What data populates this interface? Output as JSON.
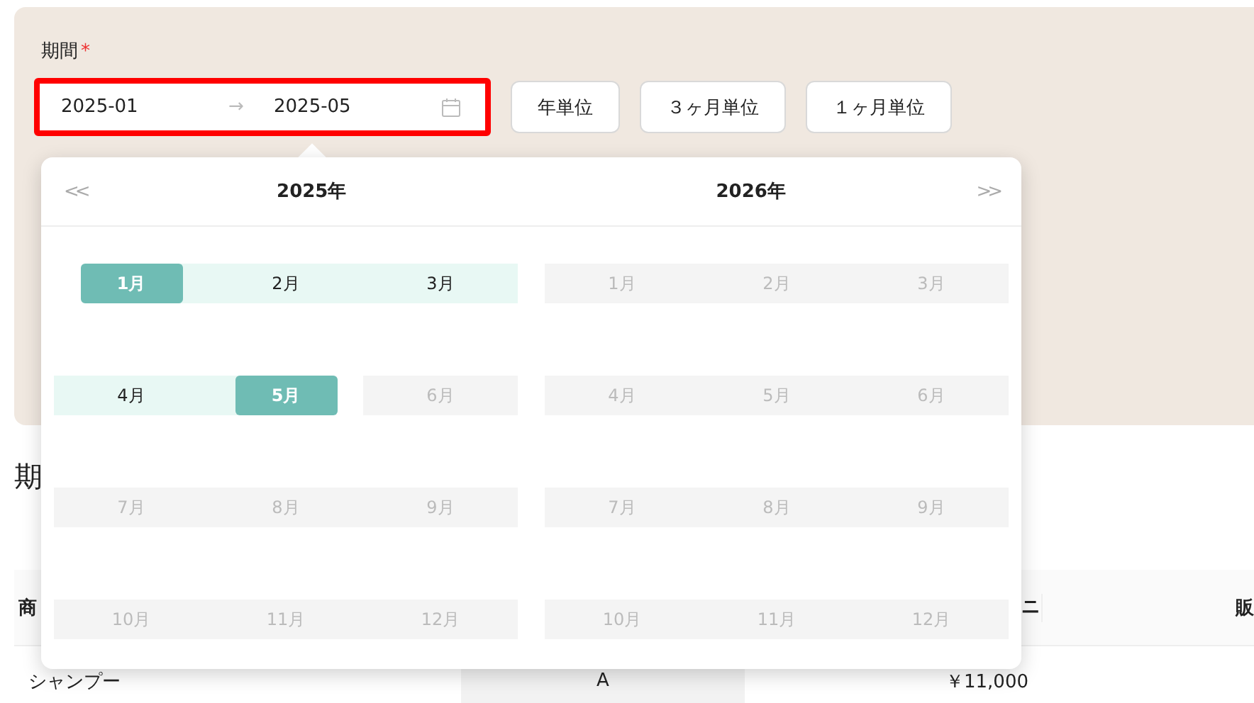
{
  "form": {
    "label": "期間",
    "required_mark": "*",
    "range": {
      "start": "2025-01",
      "separator": "→",
      "end": "2025-05",
      "highlighted": true
    },
    "buttons": [
      "年単位",
      "３ヶ月単位",
      "１ヶ月単位"
    ]
  },
  "section_heading": "期",
  "table": {
    "columns": [
      "商",
      "ニ",
      "販"
    ],
    "rows": [
      {
        "cells": [
          "シャンプー",
          "A",
          "￥11,000"
        ]
      }
    ]
  },
  "picker": {
    "prev_label": "<<",
    "next_label": ">>",
    "panels": [
      {
        "title": "2025年",
        "months": [
          {
            "label": "1月",
            "selected": true,
            "in_range": false,
            "disabled": false
          },
          {
            "label": "2月",
            "selected": false,
            "in_range": true,
            "disabled": false
          },
          {
            "label": "3月",
            "selected": false,
            "in_range": true,
            "disabled": false
          },
          {
            "label": "4月",
            "selected": false,
            "in_range": true,
            "disabled": false
          },
          {
            "label": "5月",
            "selected": true,
            "in_range": false,
            "disabled": false
          },
          {
            "label": "6月",
            "selected": false,
            "in_range": false,
            "disabled": true
          },
          {
            "label": "7月",
            "selected": false,
            "in_range": false,
            "disabled": true
          },
          {
            "label": "8月",
            "selected": false,
            "in_range": false,
            "disabled": true
          },
          {
            "label": "9月",
            "selected": false,
            "in_range": false,
            "disabled": true
          },
          {
            "label": "10月",
            "selected": false,
            "in_range": false,
            "disabled": true
          },
          {
            "label": "11月",
            "selected": false,
            "in_range": false,
            "disabled": true
          },
          {
            "label": "12月",
            "selected": false,
            "in_range": false,
            "disabled": true
          }
        ]
      },
      {
        "title": "2026年",
        "months": [
          {
            "label": "1月",
            "selected": false,
            "in_range": false,
            "disabled": true
          },
          {
            "label": "2月",
            "selected": false,
            "in_range": false,
            "disabled": true
          },
          {
            "label": "3月",
            "selected": false,
            "in_range": false,
            "disabled": true
          },
          {
            "label": "4月",
            "selected": false,
            "in_range": false,
            "disabled": true
          },
          {
            "label": "5月",
            "selected": false,
            "in_range": false,
            "disabled": true
          },
          {
            "label": "6月",
            "selected": false,
            "in_range": false,
            "disabled": true
          },
          {
            "label": "7月",
            "selected": false,
            "in_range": false,
            "disabled": true
          },
          {
            "label": "8月",
            "selected": false,
            "in_range": false,
            "disabled": true
          },
          {
            "label": "9月",
            "selected": false,
            "in_range": false,
            "disabled": true
          },
          {
            "label": "10月",
            "selected": false,
            "in_range": false,
            "disabled": true
          },
          {
            "label": "11月",
            "selected": false,
            "in_range": false,
            "disabled": true
          },
          {
            "label": "12月",
            "selected": false,
            "in_range": false,
            "disabled": true
          }
        ]
      }
    ]
  }
}
